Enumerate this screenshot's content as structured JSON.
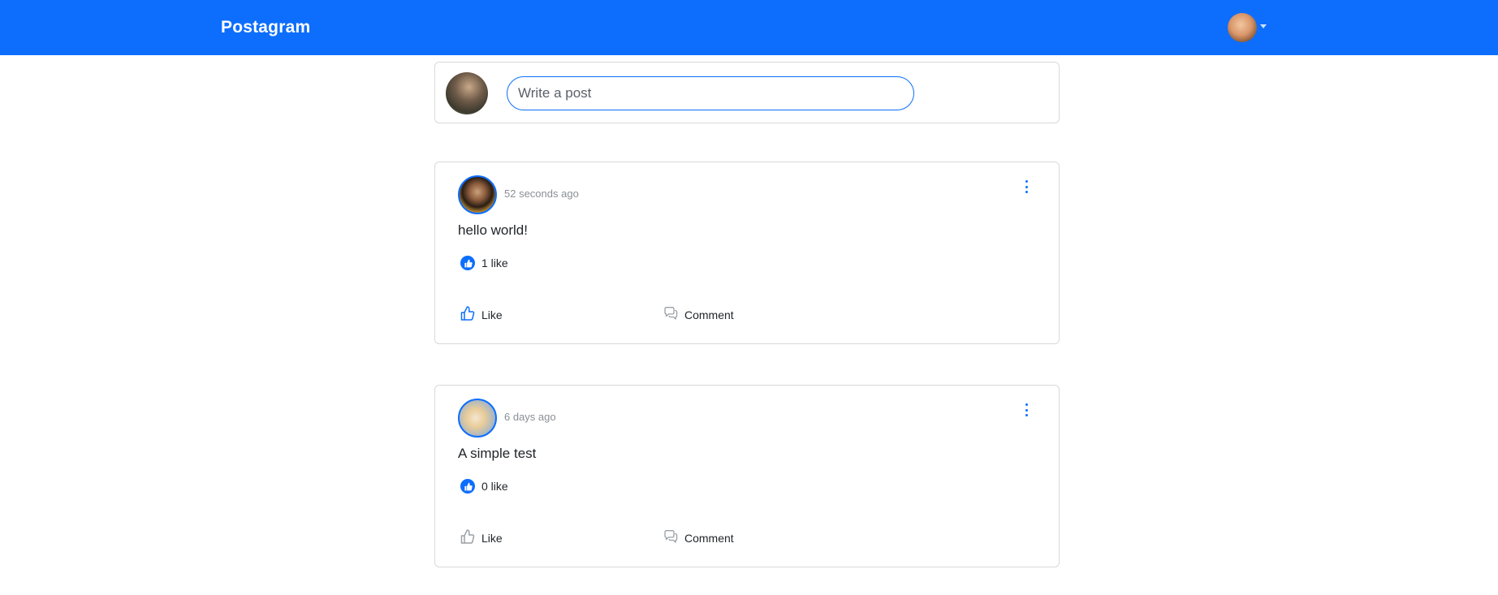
{
  "app": {
    "brand": "Postagram"
  },
  "composer": {
    "placeholder": "Write a post"
  },
  "posts": [
    {
      "time": "52 seconds ago",
      "body": "hello world!",
      "likes_text": "1 like",
      "like_label": "Like",
      "comment_label": "Comment",
      "liked": true
    },
    {
      "time": "6 days ago",
      "body": "A simple test",
      "likes_text": "0 like",
      "like_label": "Like",
      "comment_label": "Comment",
      "liked": false
    }
  ],
  "icons": {
    "like_badge": "thumbs-up-icon",
    "like_action": "thumbs-up-outline-icon",
    "comment_action": "comment-bubbles-icon",
    "menu": "more-vertical-icon"
  },
  "colors": {
    "accent": "#0d6efd",
    "border": "#d9d9d9",
    "muted_text": "#8a8f96",
    "liked_icon": "#0d6efd",
    "unliked_icon": "#9aa0a6"
  }
}
